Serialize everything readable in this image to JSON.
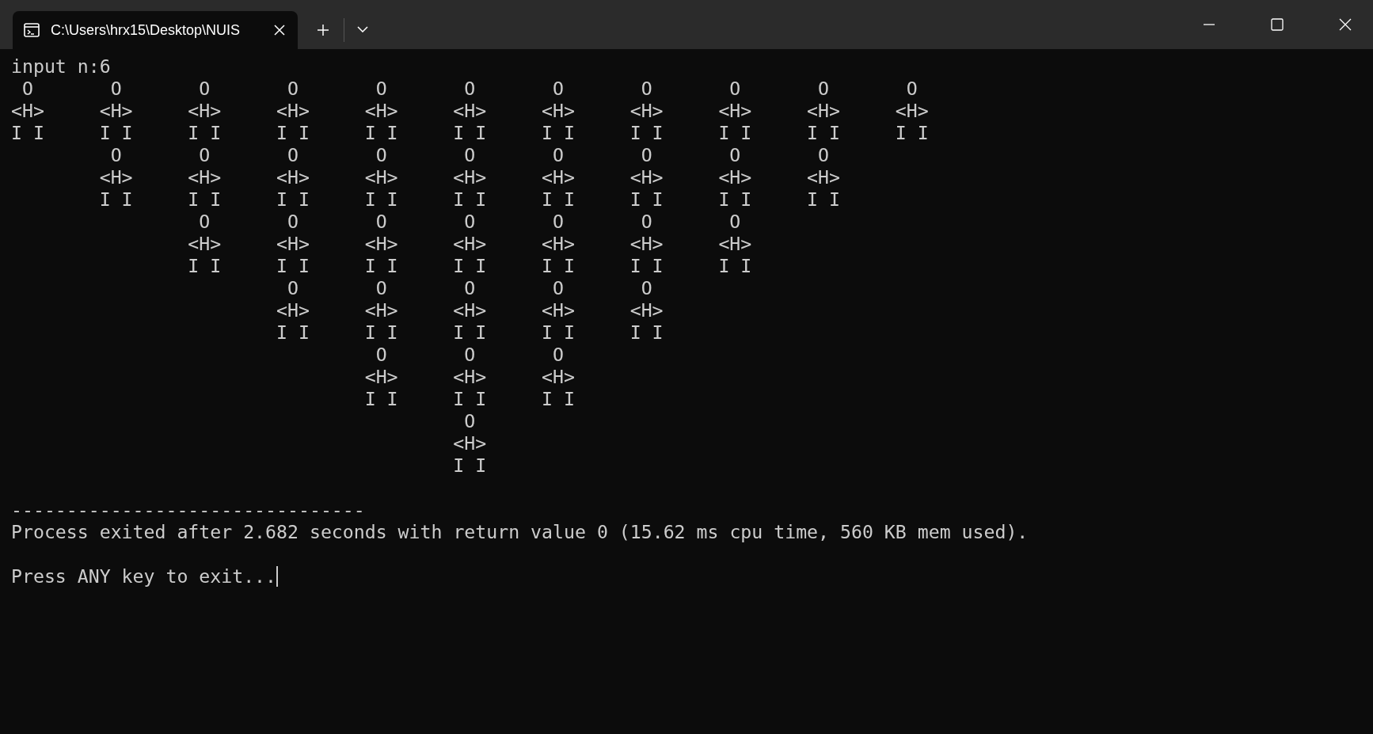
{
  "tab": {
    "title": "C:\\Users\\hrx15\\Desktop\\NUIS",
    "selected": true
  },
  "console": {
    "input_line": "input n:6",
    "figures": [
      {
        "lines": [
          "O",
          "<H>",
          "I I"
        ]
      },
      {
        "lines": [
          "O",
          "<H>",
          "I I",
          "O",
          "<H>",
          "I I"
        ]
      },
      {
        "lines": [
          "O",
          "<H>",
          "I I",
          "O",
          "<H>",
          "I I",
          "O",
          "<H>",
          "I I"
        ]
      },
      {
        "lines": [
          "O",
          "<H>",
          "I I",
          "O",
          "<H>",
          "I I",
          "O",
          "<H>",
          "I I",
          "O",
          "<H>",
          "I I"
        ]
      },
      {
        "lines": [
          "O",
          "<H>",
          "I I",
          "O",
          "<H>",
          "I I",
          "O",
          "<H>",
          "I I",
          "O",
          "<H>",
          "I I",
          "O",
          "<H>",
          "I I"
        ]
      },
      {
        "lines": [
          "O",
          "<H>",
          "I I",
          "O",
          "<H>",
          "I I",
          "O",
          "<H>",
          "I I",
          "O",
          "<H>",
          "I I",
          "O",
          "<H>",
          "I I",
          "O",
          "<H>",
          "I I"
        ]
      },
      {
        "lines": [
          "O",
          "<H>",
          "I I",
          "O",
          "<H>",
          "I I",
          "O",
          "<H>",
          "I I",
          "O",
          "<H>",
          "I I",
          "O",
          "<H>",
          "I I"
        ]
      },
      {
        "lines": [
          "O",
          "<H>",
          "I I",
          "O",
          "<H>",
          "I I",
          "O",
          "<H>",
          "I I",
          "O",
          "<H>",
          "I I"
        ]
      },
      {
        "lines": [
          "O",
          "<H>",
          "I I",
          "O",
          "<H>",
          "I I",
          "O",
          "<H>",
          "I I"
        ]
      },
      {
        "lines": [
          "O",
          "<H>",
          "I I",
          "O",
          "<H>",
          "I I"
        ]
      },
      {
        "lines": [
          "O",
          "<H>",
          "I I"
        ]
      }
    ],
    "separator": "--------------------------------",
    "exit_message": "Process exited after 2.682 seconds with return value 0 (15.62 ms cpu time, 560 KB mem used).",
    "prompt": "Press ANY key to exit..."
  }
}
